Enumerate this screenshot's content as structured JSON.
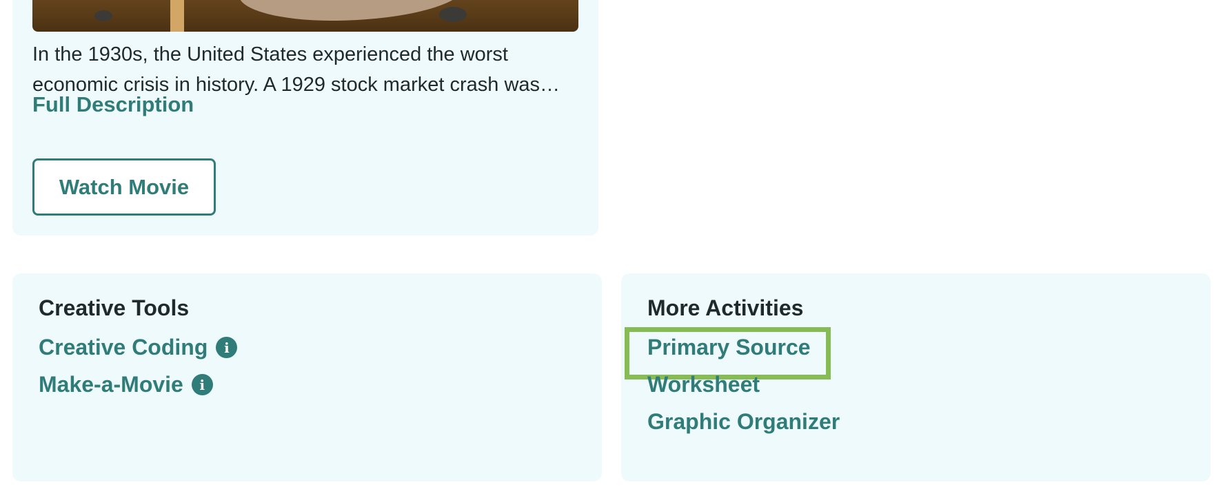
{
  "movie": {
    "description": "In the 1930s, the United States experienced the worst economic crisis in history. A 1929 stock market crash was…",
    "full_description_label": "Full Description",
    "watch_button_label": "Watch Movie"
  },
  "creative_tools": {
    "title": "Creative Tools",
    "links": [
      {
        "label": "Creative Coding",
        "icon": "info-icon"
      },
      {
        "label": "Make-a-Movie",
        "icon": "info-icon"
      }
    ]
  },
  "more_activities": {
    "title": "More Activities",
    "links": [
      {
        "label": "Primary Source",
        "highlighted": true
      },
      {
        "label": "Worksheet"
      },
      {
        "label": "Graphic Organizer"
      }
    ]
  },
  "colors": {
    "accent": "#2f7c78",
    "card_bg": "#effafd",
    "highlight": "#86bb55"
  }
}
